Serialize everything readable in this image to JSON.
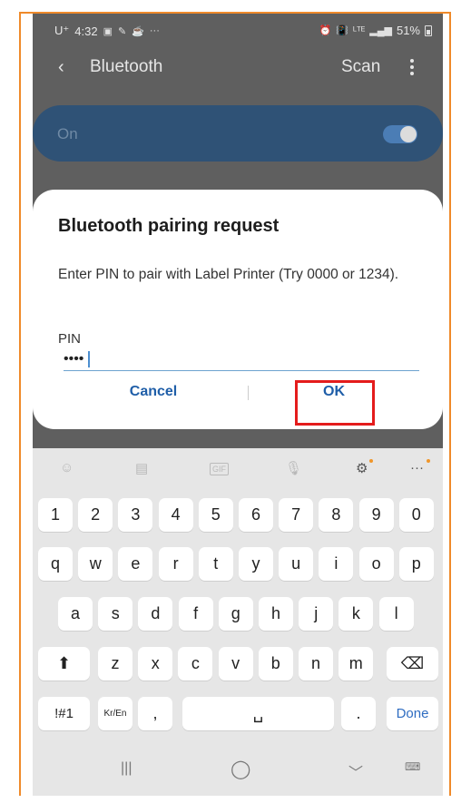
{
  "status_bar": {
    "carrier": "U⁺",
    "time": "4:32",
    "left_icons": [
      "gallery-icon",
      "pencil-icon",
      "coffee-icon",
      "more-dots-icon"
    ],
    "right_icons": [
      "alarm-icon",
      "vibrate-icon",
      "lte-icon",
      "signal-icon"
    ],
    "battery": "51%"
  },
  "app_bar": {
    "title": "Bluetooth",
    "scan_label": "Scan"
  },
  "bluetooth_toggle": {
    "label": "On",
    "state": true
  },
  "dialog": {
    "title": "Bluetooth pairing request",
    "message": "Enter PIN to pair with Label Printer (Try 0000 or 1234).",
    "pin_label": "PIN",
    "pin_value": "••••",
    "cancel_label": "Cancel",
    "ok_label": "OK"
  },
  "keyboard": {
    "number_row": [
      "1",
      "2",
      "3",
      "4",
      "5",
      "6",
      "7",
      "8",
      "9",
      "0"
    ],
    "row1": [
      "q",
      "w",
      "e",
      "r",
      "t",
      "y",
      "u",
      "i",
      "o",
      "p"
    ],
    "row2": [
      "a",
      "s",
      "d",
      "f",
      "g",
      "h",
      "j",
      "k",
      "l"
    ],
    "row3": [
      "z",
      "x",
      "c",
      "v",
      "b",
      "n",
      "m"
    ],
    "symbols_label": "!#1",
    "lang_label": "Kr/En",
    "comma": ",",
    "period": ".",
    "done_label": "Done",
    "toolbar_gif": "GIF",
    "accent_color": "#2e6cc1"
  },
  "colors": {
    "highlight": "#e41c1c",
    "frame": "#ef8a2a",
    "dialog_button": "#1f5ea8"
  }
}
